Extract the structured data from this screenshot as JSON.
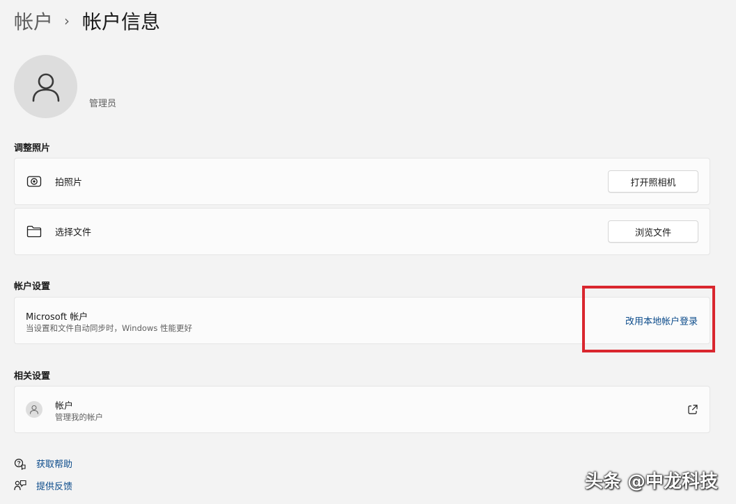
{
  "breadcrumb": {
    "parent": "帐户",
    "separator": "›",
    "current": "帐户信息"
  },
  "user": {
    "name": "管理员"
  },
  "photo_section": {
    "title": "调整照片",
    "items": [
      {
        "icon": "camera-icon",
        "label": "拍照片",
        "button": "打开照相机"
      },
      {
        "icon": "folder-icon",
        "label": "选择文件",
        "button": "浏览文件"
      }
    ]
  },
  "account_settings": {
    "title": "帐户设置",
    "microsoft_account": {
      "title": "Microsoft 帐户",
      "description": "当设置和文件自动同步时，Windows 性能更好",
      "link": "改用本地帐户登录"
    }
  },
  "related_settings": {
    "title": "相关设置",
    "accounts": {
      "title": "帐户",
      "description": "管理我的帐户",
      "icon": "external-link-icon"
    }
  },
  "footer_links": [
    {
      "icon": "help-icon",
      "label": "获取帮助"
    },
    {
      "icon": "feedback-icon",
      "label": "提供反馈"
    }
  ],
  "watermark": "头条 @中龙科技",
  "colors": {
    "background": "#f3f3f3",
    "card": "#fbfbfb",
    "link": "#0a4a8a",
    "highlight": "#d9262e"
  }
}
